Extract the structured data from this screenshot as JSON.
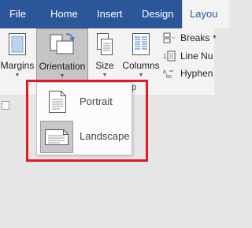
{
  "tabs": [
    {
      "label": "File",
      "active": false
    },
    {
      "label": "Home",
      "active": false
    },
    {
      "label": "Insert",
      "active": false
    },
    {
      "label": "Design",
      "active": false
    },
    {
      "label": "Layou",
      "active": true
    }
  ],
  "ribbon": {
    "margins_label": "Margins",
    "orientation_label": "Orientation",
    "size_label": "Size",
    "columns_label": "Columns",
    "breaks_label": "Breaks",
    "line_numbers_label": "Line Nu",
    "hyphenation_label": "Hyphen",
    "group_label": "ıp"
  },
  "orientation_menu": {
    "items": [
      {
        "label": "Portrait",
        "selected": false
      },
      {
        "label": "Landscape",
        "selected": true
      }
    ]
  },
  "colors": {
    "title_bar": "#2b579a",
    "ribbon_bg": "#f3f3f3",
    "highlight_border": "#e01b24",
    "selected_bg": "#c8c8c8"
  }
}
